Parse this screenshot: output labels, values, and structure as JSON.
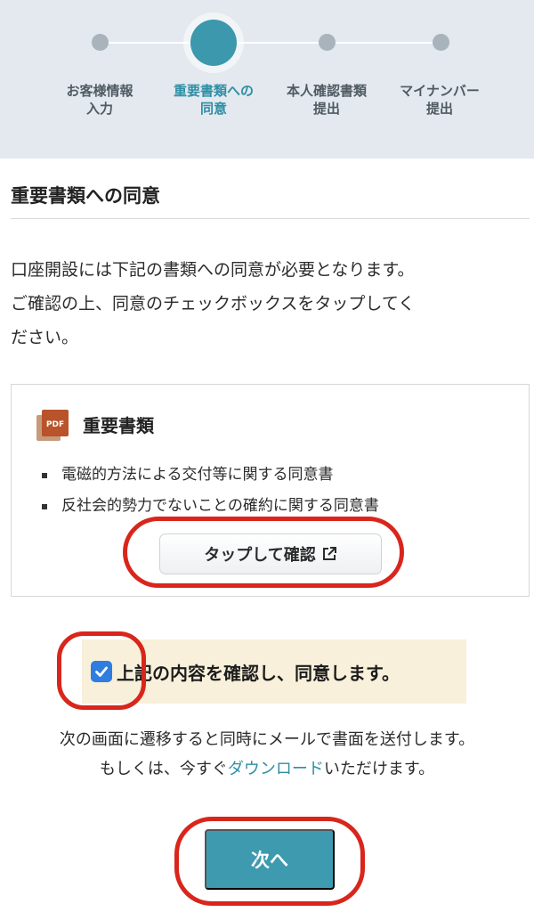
{
  "stepper": {
    "steps": [
      {
        "line1": "お客様情報",
        "line2": "入力",
        "active": false
      },
      {
        "line1": "重要書類への",
        "line2": "同意",
        "active": true
      },
      {
        "line1": "本人確認書類",
        "line2": "提出",
        "active": false
      },
      {
        "line1": "マイナンバー",
        "line2": "提出",
        "active": false
      }
    ]
  },
  "section": {
    "title": "重要書類への同意"
  },
  "intro": {
    "line1": "口座開設には下記の書類への同意が必要となります。",
    "line2": "ご確認の上、同意のチェックボックスをタップしてく",
    "line3": "ださい。"
  },
  "documents": {
    "icon": "pdf-icon",
    "icon_label": "PDF",
    "title": "重要書類",
    "items": [
      "電磁的方法による交付等に関する同意書",
      "反社会的勢力でないことの確約に関する同意書"
    ],
    "confirm_label": "タップして確認"
  },
  "agreement": {
    "checked": true,
    "label": "上記の内容を確認し、同意します。"
  },
  "notice": {
    "line1": "次の画面に遷移すると同時にメールで書面を送付します。",
    "line2_prefix": "もしくは、今すぐ",
    "link_text": "ダウンロード",
    "line2_suffix": "いただけます。"
  },
  "next_button": {
    "label": "次へ"
  },
  "colors": {
    "accent": "#3b98ad",
    "annotation": "#d9261c",
    "checkbox": "#2f7de0",
    "agree_bg": "#f8f0da"
  }
}
